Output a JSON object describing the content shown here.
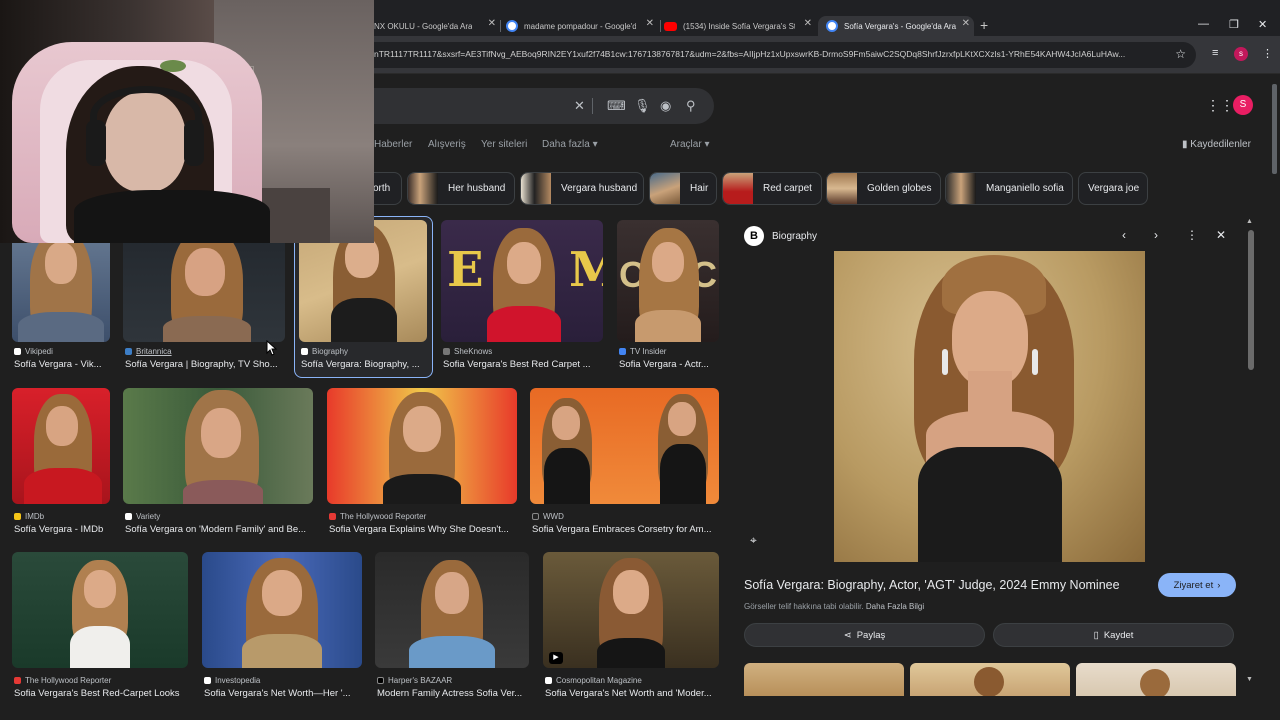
{
  "browser": {
    "tabs": [
      {
        "title": "NX OKULU - Google'da Ara",
        "fav": "google-icon",
        "color": "#4285f4"
      },
      {
        "title": "madame pompadour - Google'da Ara",
        "fav": "google-icon",
        "color": "#4285f4"
      },
      {
        "title": "(1534) Inside Sofía Vergara's St",
        "fav": "youtube-icon",
        "color": "#ff0000"
      },
      {
        "title": "Sofía Vergara's - Google'da Ara",
        "fav": "google-icon",
        "color": "#4285f4"
      }
    ],
    "new_tab": "+",
    "url": "nTR1117TR1117&sxsrf=AE3TifNvg_AEBoq9RIN2EY1xuf2f74B1cw:1767138767817&udm=2&fbs=AIIjpHz1xUpxswrKB-DrmoS9Fm5aiwC2SQDq8ShrfJzrxfpLKtXCXzls1-YRhE54KAHW4JcIA6LuHAw...",
    "profile_initial": "s"
  },
  "google": {
    "avatar_initial": "S",
    "nav": [
      "Haberler",
      "Alışveriş",
      "Yer siteleri",
      "Daha fazla ▾",
      "Araçlar ▾"
    ],
    "saved": "Kaydedilenler",
    "chips": [
      "orth",
      "Her husband",
      "Vergara husband",
      "Hair",
      "Red carpet",
      "Golden globes",
      "Manganiello sofia",
      "Vergara joe"
    ]
  },
  "results": [
    {
      "source": "Vikipedi",
      "title": "Sofía Vergara - Vik..."
    },
    {
      "source": "Britannica",
      "title": "Sofía Vergara | Biography, TV Sho..."
    },
    {
      "source": "Biography",
      "title": "Sofía Vergara: Biography, ..."
    },
    {
      "source": "SheKnows",
      "title": "Sofia Vergara's Best Red Carpet ..."
    },
    {
      "source": "TV Insider",
      "title": "Sofia Vergara - Actr..."
    },
    {
      "source": "IMDb",
      "title": "Sofía Vergara - IMDb"
    },
    {
      "source": "Variety",
      "title": "Sofía Vergara on 'Modern Family' and Be..."
    },
    {
      "source": "The Hollywood Reporter",
      "title": "Sofia Vergara Explains Why She Doesn't..."
    },
    {
      "source": "WWD",
      "title": "Sofia Vergara Embraces Corsetry for Am..."
    },
    {
      "source": "The Hollywood Reporter",
      "title": "Sofia Vergara's Best Red-Carpet Looks"
    },
    {
      "source": "Investopedia",
      "title": "Sofia Vergara's Net Worth—Her '..."
    },
    {
      "source": "Harper's BAZAAR",
      "title": "Modern Family Actress Sofia Ver..."
    },
    {
      "source": "Cosmopolitan Magazine",
      "title": "Sofia Vergara's Net Worth and 'Moder..."
    }
  ],
  "panel": {
    "source": "Biography",
    "title": "Sofía Vergara: Biography, Actor, 'AGT' Judge, 2024 Emmy Nominee",
    "visit": "Ziyaret et",
    "copyright": "Görseller telif hakkına tabi olabilir.",
    "more_info": "Daha Fazla Bilgi",
    "share": "Paylaş",
    "save": "Kaydet"
  }
}
